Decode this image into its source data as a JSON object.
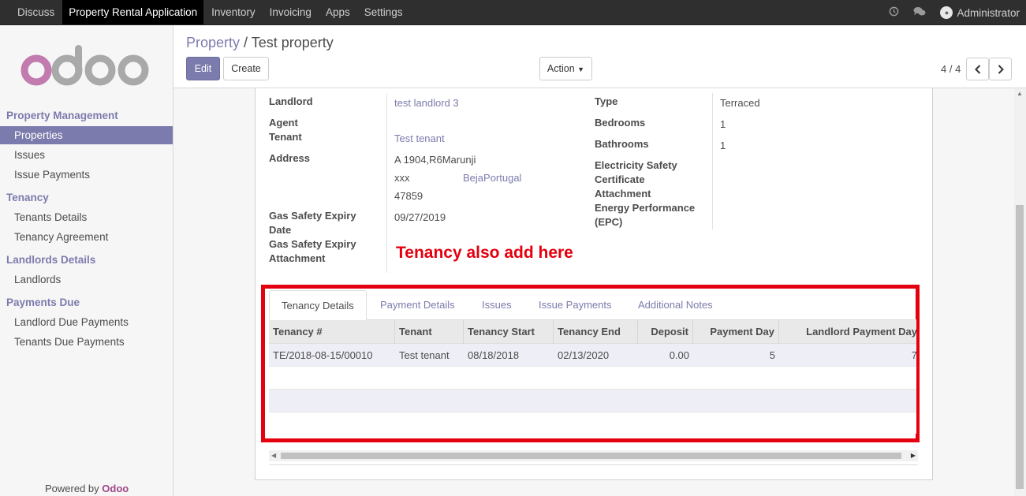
{
  "topnav": {
    "items": [
      "Discuss",
      "Property Rental Application",
      "Inventory",
      "Invoicing",
      "Apps",
      "Settings"
    ],
    "user": "Administrator"
  },
  "sidebar": {
    "sections": [
      {
        "title": "Property Management",
        "items": [
          "Properties",
          "Issues",
          "Issue Payments"
        ]
      },
      {
        "title": "Tenancy",
        "items": [
          "Tenants Details",
          "Tenancy Agreement"
        ]
      },
      {
        "title": "Landlords Details",
        "items": [
          "Landlords"
        ]
      },
      {
        "title": "Payments Due",
        "items": [
          "Landlord Due Payments",
          "Tenants Due Payments"
        ]
      }
    ],
    "powered_by": "Powered by",
    "powered_brand": "Odoo",
    "logo_text": "odoo"
  },
  "breadcrumb": {
    "parent": "Property",
    "separator": "/",
    "current": "Test property"
  },
  "buttons": {
    "edit": "Edit",
    "create": "Create",
    "action": "Action"
  },
  "pager": {
    "text": "4 / 4"
  },
  "form": {
    "left": {
      "landlord_label": "Landlord",
      "landlord_value": "test landlord 3",
      "agent_label": "Agent",
      "tenant_label": "Tenant",
      "tenant_value": "Test tenant",
      "address_label": "Address",
      "address_line1": "A 1904,R6Marunji",
      "address_city": "xxx",
      "address_state_country": "BejaPortugal",
      "address_zip": "47859",
      "gas_expiry_label_1": "Gas Safety Expiry",
      "gas_expiry_label_2": "Date",
      "gas_expiry_value": "09/27/2019",
      "gas_attach_label_1": "Gas Safety Expiry",
      "gas_attach_label_2": "Attachment"
    },
    "right": {
      "type_label": "Type",
      "type_value": "Terraced",
      "bedrooms_label": "Bedrooms",
      "bedrooms_value": "1",
      "bathrooms_label": "Bathrooms",
      "bathrooms_value": "1",
      "elec_label_1": "Electricity Safety",
      "elec_label_2": "Certificate",
      "elec_label_3": "Attachment",
      "epc_label_1": "Energy Performance",
      "epc_label_2": "(EPC)"
    }
  },
  "annotation": "Tenancy also add here",
  "tabs": [
    "Tenancy Details",
    "Payment Details",
    "Issues",
    "Issue Payments",
    "Additional Notes"
  ],
  "table": {
    "headers": [
      "Tenancy #",
      "Tenant",
      "Tenancy Start",
      "Tenancy End",
      "Deposit",
      "Payment Day",
      "Landlord Payment Day"
    ],
    "rows": [
      [
        "TE/2018-08-15/00010",
        "Test tenant",
        "08/18/2018",
        "02/13/2020",
        "0.00",
        "5",
        "7"
      ]
    ]
  }
}
